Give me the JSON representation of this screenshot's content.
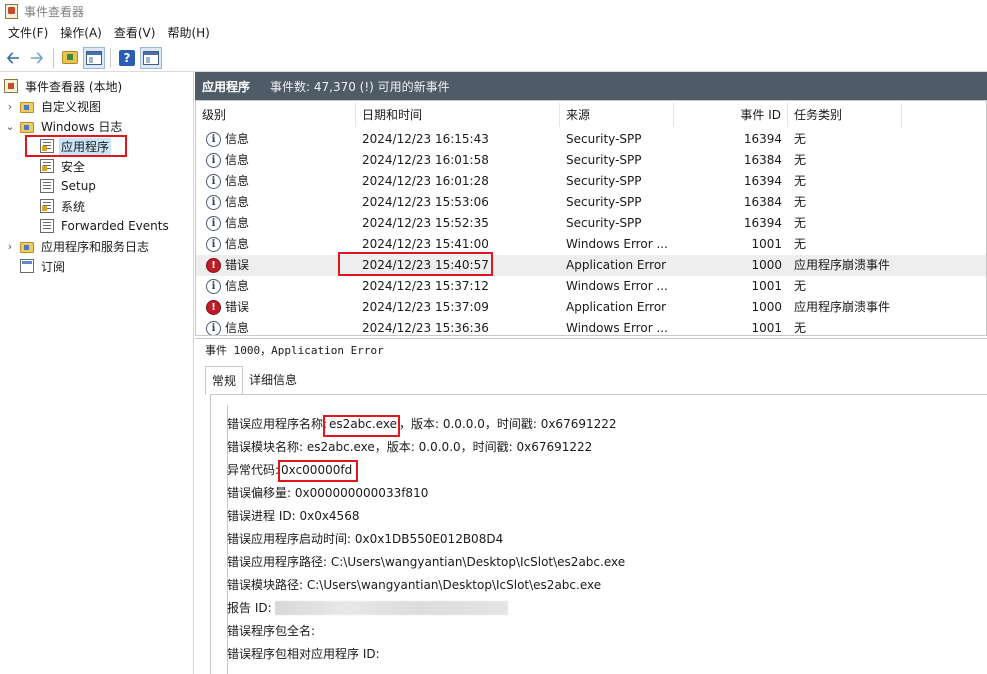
{
  "window": {
    "title": "事件查看器"
  },
  "menu": [
    "文件(F)",
    "操作(A)",
    "查看(V)",
    "帮助(H)"
  ],
  "tree": {
    "root": "事件查看器 (本地)",
    "custom_views": "自定义视图",
    "windows_logs": "Windows 日志",
    "logs": [
      "应用程序",
      "安全",
      "Setup",
      "系统",
      "Forwarded Events"
    ],
    "app_service_logs": "应用程序和服务日志",
    "subscriptions": "订阅"
  },
  "header": {
    "name": "应用程序",
    "info": "事件数: 47,370 (!) 可用的新事件"
  },
  "columns": {
    "level": "级别",
    "datetime": "日期和时间",
    "source": "来源",
    "event_id": "事件 ID",
    "category": "任务类别"
  },
  "events": [
    {
      "level": "信息",
      "datetime": "2024/12/23 16:15:43",
      "source": "Security-SPP",
      "event_id": "16394",
      "category": "无"
    },
    {
      "level": "信息",
      "datetime": "2024/12/23 16:01:58",
      "source": "Security-SPP",
      "event_id": "16384",
      "category": "无"
    },
    {
      "level": "信息",
      "datetime": "2024/12/23 16:01:28",
      "source": "Security-SPP",
      "event_id": "16394",
      "category": "无"
    },
    {
      "level": "信息",
      "datetime": "2024/12/23 15:53:06",
      "source": "Security-SPP",
      "event_id": "16384",
      "category": "无"
    },
    {
      "level": "信息",
      "datetime": "2024/12/23 15:52:35",
      "source": "Security-SPP",
      "event_id": "16394",
      "category": "无"
    },
    {
      "level": "信息",
      "datetime": "2024/12/23 15:41:00",
      "source": "Windows Error ...",
      "event_id": "1001",
      "category": "无"
    },
    {
      "level": "错误",
      "datetime": "2024/12/23 15:40:57",
      "source": "Application Error",
      "event_id": "1000",
      "category": "应用程序崩溃事件"
    },
    {
      "level": "信息",
      "datetime": "2024/12/23 15:37:12",
      "source": "Windows Error ...",
      "event_id": "1001",
      "category": "无"
    },
    {
      "level": "错误",
      "datetime": "2024/12/23 15:37:09",
      "source": "Application Error",
      "event_id": "1000",
      "category": "应用程序崩溃事件"
    },
    {
      "level": "信息",
      "datetime": "2024/12/23 15:36:36",
      "source": "Windows Error ...",
      "event_id": "1001",
      "category": "无"
    }
  ],
  "detail": {
    "title": "事件 1000，Application Error",
    "tabs": [
      "常规",
      "详细信息"
    ],
    "line1_prefix": "错误应用程序名称:",
    "line1_app": "es2abc.exe",
    "line1_suffix": "，版本: 0.0.0.0，时间戳: 0x67691222",
    "line2": "错误模块名称: es2abc.exe，版本: 0.0.0.0，时间戳: 0x67691222",
    "line3_prefix": "异常代码:",
    "line3_code": "0xc00000fd",
    "line4": "错误偏移量: 0x000000000033f810",
    "line5": "错误进程 ID: 0x0x4568",
    "line6": "错误应用程序启动时间: 0x0x1DB550E012B08D4",
    "line7": "错误应用程序路径: C:\\Users\\wangyantian\\Desktop\\IcSlot\\es2abc.exe",
    "line8": "错误模块路径: C:\\Users\\wangyantian\\Desktop\\IcSlot\\es2abc.exe",
    "line9": "报告 ID: 2",
    "line10": "错误程序包全名:",
    "line11": "错误程序包相对应用程序 ID:"
  }
}
